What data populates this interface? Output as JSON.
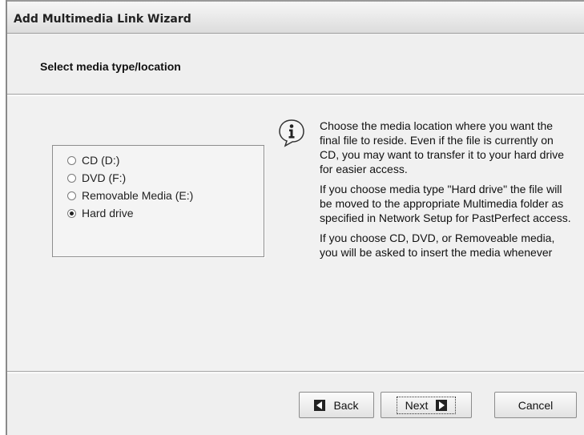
{
  "window": {
    "title": "Add Multimedia Link Wizard"
  },
  "header": {
    "subtitle": "Select media type/location"
  },
  "media_options": [
    {
      "label": "CD (D:)",
      "selected": false
    },
    {
      "label": "DVD (F:)",
      "selected": false
    },
    {
      "label": "Removable Media (E:)",
      "selected": false
    },
    {
      "label": "Hard drive",
      "selected": true
    }
  ],
  "info": {
    "icon": "info-icon",
    "paragraphs": [
      "Choose the media location where you want the final file to reside.  Even if the file is currently on CD, you may want to transfer it to your hard drive for easier access.",
      "If you choose media type \"Hard drive\" the file will be moved to the appropriate Multimedia folder as specified in Network Setup for PastPerfect access.",
      "If you choose CD, DVD, or Removeable media, you will be asked to insert the media whenever"
    ]
  },
  "buttons": {
    "back": "Back",
    "next": "Next",
    "cancel": "Cancel"
  }
}
